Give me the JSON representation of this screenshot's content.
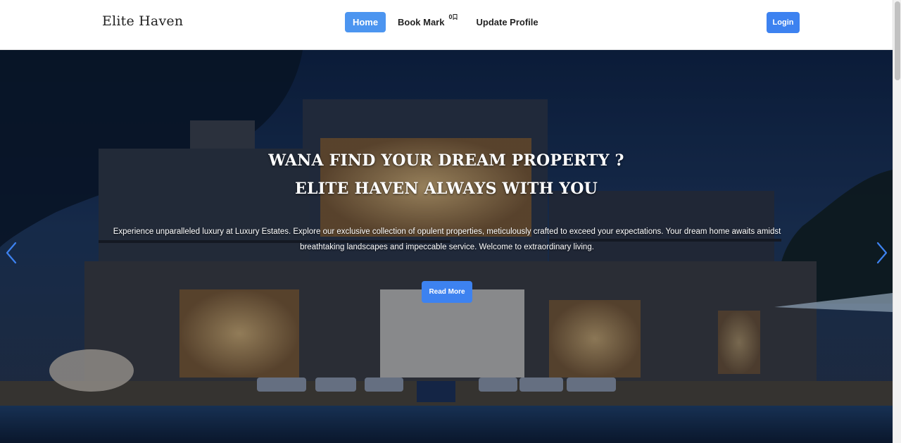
{
  "brand": "Elite Haven",
  "nav": {
    "home": "Home",
    "bookmark": "Book Mark",
    "bookmark_count": "0",
    "update_profile": "Update Profile",
    "login": "Login"
  },
  "hero": {
    "title_line1": "WANA FIND YOUR DREAM PROPERTY ?",
    "title_line2": "ELITE HAVEN ALWAYS WITH YOU",
    "description": "Experience unparalleled luxury at Luxury Estates. Explore our exclusive collection of opulent properties, meticulously crafted to exceed your expectations. Your dream home awaits amidst breathtaking landscapes and impeccable service. Welcome to extraordinary living.",
    "cta": "Read More"
  },
  "icons": {
    "bookmark": "bookmark-icon",
    "prev": "chevron-left-icon",
    "next": "chevron-right-icon"
  },
  "colors": {
    "accent": "#3d82f0",
    "home_active": "#4c95f0",
    "arrow": "#3d82f0"
  }
}
